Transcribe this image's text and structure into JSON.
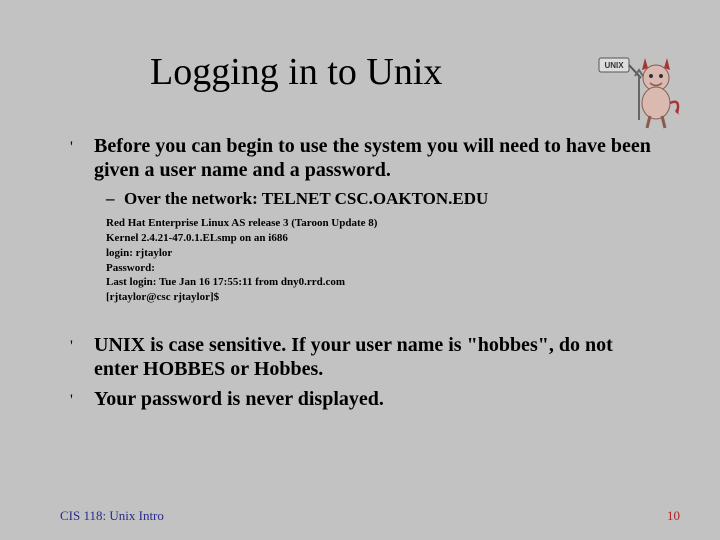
{
  "title": "Logging in to Unix",
  "bullets": [
    {
      "text": "Before you can begin to use the system you will need to have been given a user name and a password.",
      "sub": "Over the network: TELNET CSC.OAKTON.EDU",
      "terminal": [
        "Red Hat Enterprise Linux AS release 3 (Taroon Update 8)",
        "Kernel 2.4.21-47.0.1.ELsmp on an i686",
        "login: rjtaylor",
        "Password:",
        "Last login: Tue Jan 16 17:55:11 from dny0.rrd.com",
        "[rjtaylor@csc rjtaylor]$"
      ]
    },
    {
      "text": "UNIX is case sensitive. If your user name is \"hobbes\", do not enter HOBBES or Hobbes."
    },
    {
      "text": "Your password is never displayed."
    }
  ],
  "footer": {
    "left": "CIS 118: Unix Intro",
    "right": "10"
  },
  "mascot": {
    "name": "bsd-daemon",
    "flag_text": "UNIX"
  }
}
